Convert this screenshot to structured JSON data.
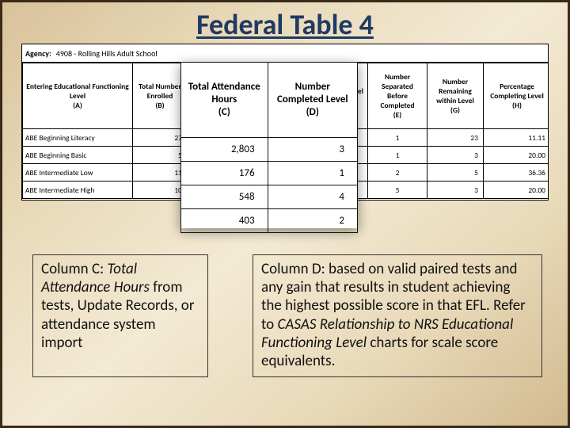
{
  "title": "Federal Table 4",
  "agency": {
    "label": "Agency:",
    "value": "4908 - Rolling Hills Adult School"
  },
  "headers": {
    "A": "Entering Educational Functioning Level\n(A)",
    "B": "Total Number Enrolled\n(B)",
    "C": "Total Attendance Hours\n(C)",
    "D": "Number Completed Level\n(D)",
    "E": "Number Separated Before Completed\n(E)",
    "F": "Number Remaining within Level\n(G)",
    "G": "Percentage Completing Level\n(H)"
  },
  "rows": [
    {
      "level": "ABE Beginning Literacy",
      "enrolled": "27",
      "sep": "1",
      "remain": "23",
      "pct": "11.11"
    },
    {
      "level": "ABE Beginning Basic",
      "enrolled": "5",
      "sep": "1",
      "remain": "3",
      "pct": "20.00"
    },
    {
      "level": "ABE Intermediate Low",
      "enrolled": "11",
      "sep": "2",
      "remain": "5",
      "pct": "36.36"
    },
    {
      "level": "ABE Intermediate High",
      "enrolled": "10",
      "sep": "5",
      "remain": "3",
      "pct": "20.00"
    }
  ],
  "overlay": {
    "headerC": "Total Attendance Hours\n(C)",
    "headerD": "Number Completed Level\n(D)",
    "rows": [
      {
        "hours": "2,803",
        "completed": "3"
      },
      {
        "hours": "176",
        "completed": "1"
      },
      {
        "hours": "548",
        "completed": "4"
      },
      {
        "hours": "403",
        "completed": "2"
      }
    ]
  },
  "noteC": {
    "lead": "Column C:",
    "ital": " Total Attendance Hours ",
    "rest": "from tests, Update Records, or attendance system import"
  },
  "noteD": {
    "lead": "Column D:",
    "mid": " based on valid paired tests and any gain that results in student achieving the highest possible score in that EFL. Refer to ",
    "ital": "CASAS Relationship to NRS Educational Functioning Level",
    "rest": " charts for scale score equivalents."
  },
  "chart_data": {
    "type": "table",
    "title": "Federal Table 4",
    "columns": [
      "Entering Educational Functioning Level (A)",
      "Total Number Enrolled (B)",
      "Total Attendance Hours (C)",
      "Number Completed Level (D)",
      "Number Separated Before Completed (E)",
      "Number Remaining within Level (G)",
      "Percentage Completing Level (H)"
    ],
    "rows": [
      [
        "ABE Beginning Literacy",
        27,
        2803,
        3,
        1,
        23,
        11.11
      ],
      [
        "ABE Beginning Basic",
        5,
        176,
        1,
        1,
        3,
        20.0
      ],
      [
        "ABE Intermediate Low",
        11,
        548,
        4,
        2,
        5,
        36.36
      ],
      [
        "ABE Intermediate High",
        10,
        403,
        2,
        5,
        3,
        20.0
      ]
    ]
  }
}
